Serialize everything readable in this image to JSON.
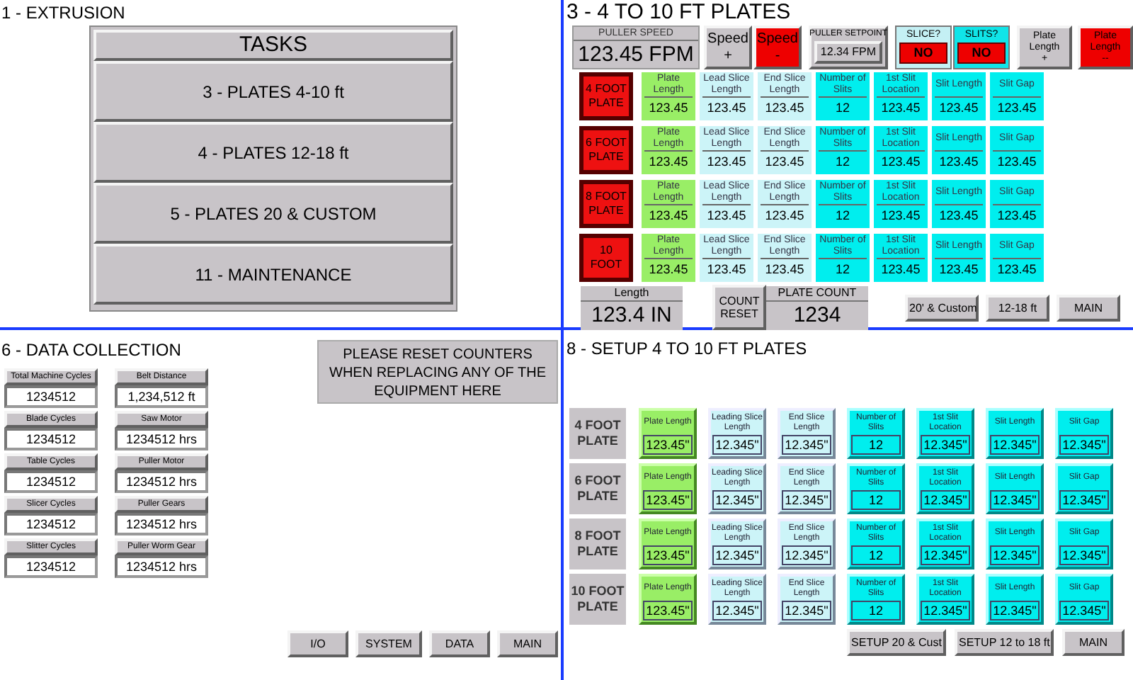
{
  "extrusion": {
    "title": "1 - EXTRUSION",
    "tasks_title": "TASKS",
    "tasks": [
      "3 - PLATES 4-10 ft",
      "4 - PLATES 12-18 ft",
      "5 - PLATES 20 & CUSTOM",
      "11 - MAINTENANCE"
    ]
  },
  "plates": {
    "title": "3 - 4 TO 10 FT PLATES",
    "controls": [
      {
        "kind": "readout",
        "label": "PULLER SPEED",
        "value": "123.45 FPM"
      },
      {
        "kind": "button",
        "label": "Speed",
        "sign": "+",
        "color": "#c8c4c8"
      },
      {
        "kind": "button",
        "label": "Speed",
        "sign": "-",
        "color": "#ee0000"
      },
      {
        "kind": "setpoint",
        "label": "PULLER SETPOINT",
        "value": "12.34 FPM"
      },
      {
        "kind": "toggle",
        "label": "SLICE?",
        "value": "NO",
        "color": "#c4f0f4"
      },
      {
        "kind": "toggle",
        "label": "SLITS?",
        "value": "NO",
        "color": "#10e4e8"
      },
      {
        "kind": "small_button",
        "label": "Plate Length",
        "sign": "+",
        "color": "#c8c4c8"
      },
      {
        "kind": "small_button",
        "label": "Plate Length",
        "sign": "--",
        "color": "#ee0000"
      }
    ],
    "rows": [
      {
        "label": "4 FOOT PLATE",
        "fields": [
          {
            "kind": "plate",
            "label": "Plate Length",
            "value": "123.45"
          },
          {
            "kind": "slice",
            "label": "Lead Slice Length",
            "value": "123.45"
          },
          {
            "kind": "slice",
            "label": "End Slice Length",
            "value": "123.45"
          },
          {
            "kind": "slit",
            "label": "Number of Slits",
            "value": "12"
          },
          {
            "kind": "slit",
            "label": "1st Slit Location",
            "value": "123.45"
          },
          {
            "kind": "slit",
            "label": "Slit Length",
            "value": "123.45"
          },
          {
            "kind": "slit",
            "label": "Slit Gap",
            "value": "123.45"
          }
        ]
      },
      {
        "label": "6 FOOT PLATE",
        "fields": [
          {
            "kind": "plate",
            "label": "Plate Length",
            "value": "123.45"
          },
          {
            "kind": "slice",
            "label": "Lead Slice Length",
            "value": "123.45"
          },
          {
            "kind": "slice",
            "label": "End Slice Length",
            "value": "123.45"
          },
          {
            "kind": "slit",
            "label": "Number of Slits",
            "value": "12"
          },
          {
            "kind": "slit",
            "label": "1st Slit Location",
            "value": "123.45"
          },
          {
            "kind": "slit",
            "label": "Slit Length",
            "value": "123.45"
          },
          {
            "kind": "slit",
            "label": "Slit Gap",
            "value": "123.45"
          }
        ]
      },
      {
        "label": "8 FOOT PLATE",
        "fields": [
          {
            "kind": "plate",
            "label": "Plate Length",
            "value": "123.45"
          },
          {
            "kind": "slice",
            "label": "Lead Slice Length",
            "value": "123.45"
          },
          {
            "kind": "slice",
            "label": "End Slice Length",
            "value": "123.45"
          },
          {
            "kind": "slit",
            "label": "Number of Slits",
            "value": "12"
          },
          {
            "kind": "slit",
            "label": "1st Slit Location",
            "value": "123.45"
          },
          {
            "kind": "slit",
            "label": "Slit Length",
            "value": "123.45"
          },
          {
            "kind": "slit",
            "label": "Slit Gap",
            "value": "123.45"
          }
        ]
      },
      {
        "label": "10 FOOT",
        "fields": [
          {
            "kind": "plate",
            "label": "Plate Length",
            "value": "123.45"
          },
          {
            "kind": "slice",
            "label": "Lead Slice Length",
            "value": "123.45"
          },
          {
            "kind": "slice",
            "label": "End Slice Length",
            "value": "123.45"
          },
          {
            "kind": "slit",
            "label": "Number of Slits",
            "value": "12"
          },
          {
            "kind": "slit",
            "label": "1st Slit Location",
            "value": "123.45"
          },
          {
            "kind": "slit",
            "label": "Slit Length",
            "value": "123.45"
          },
          {
            "kind": "slit",
            "label": "Slit Gap",
            "value": "123.45"
          }
        ]
      }
    ],
    "length": {
      "label": "Length",
      "value": "123.4 IN"
    },
    "count_reset": "COUNT RESET",
    "plate_count": {
      "label": "PLATE COUNT",
      "value": "1234"
    },
    "nav": [
      "20' & Custom",
      "12-18 ft",
      "MAIN"
    ]
  },
  "data_collection": {
    "title": "6 - DATA COLLECTION",
    "counters": [
      {
        "label": "Total Machine Cycles",
        "value": "1234512"
      },
      {
        "label": "Belt Distance",
        "value": "1,234,512 ft"
      },
      {
        "label": "Blade Cycles",
        "value": "1234512"
      },
      {
        "label": "Saw Motor",
        "value": "1234512 hrs"
      },
      {
        "label": "Table Cycles",
        "value": "1234512"
      },
      {
        "label": "Puller Motor",
        "value": "1234512 hrs"
      },
      {
        "label": "Slicer Cycles",
        "value": "1234512"
      },
      {
        "label": "Puller Gears",
        "value": "1234512 hrs"
      },
      {
        "label": "Slitter Cycles",
        "value": "1234512"
      },
      {
        "label": "Puller Worm Gear",
        "value": "1234512 hrs"
      }
    ],
    "notice": "PLEASE RESET COUNTERS WHEN REPLACING ANY OF THE EQUIPMENT HERE",
    "nav": [
      "I/O",
      "SYSTEM",
      "DATA",
      "MAIN"
    ]
  },
  "setup": {
    "title": "8 - SETUP 4 TO 10 FT PLATES",
    "rows": [
      {
        "label": "4 FOOT PLATE",
        "fields": [
          {
            "kind": "plate",
            "label": "Plate Length",
            "value": "123.45\""
          },
          {
            "kind": "slice",
            "label": "Leading Slice Length",
            "value": "12.345\""
          },
          {
            "kind": "slice",
            "label": "End Slice Length",
            "value": "12.345\""
          },
          {
            "kind": "slit",
            "label": "Number of Slits",
            "value": "12"
          },
          {
            "kind": "slit",
            "label": "1st Slit Location",
            "value": "12.345\""
          },
          {
            "kind": "slit",
            "label": "Slit Length",
            "value": "12.345\""
          },
          {
            "kind": "slit",
            "label": "Slit Gap",
            "value": "12.345\""
          }
        ]
      },
      {
        "label": "6 FOOT PLATE",
        "fields": [
          {
            "kind": "plate",
            "label": "Plate Length",
            "value": "123.45\""
          },
          {
            "kind": "slice",
            "label": "Leading Slice Length",
            "value": "12.345\""
          },
          {
            "kind": "slice",
            "label": "End Slice Length",
            "value": "12.345\""
          },
          {
            "kind": "slit",
            "label": "Number of Slits",
            "value": "12"
          },
          {
            "kind": "slit",
            "label": "1st Slit Location",
            "value": "12.345\""
          },
          {
            "kind": "slit",
            "label": "Slit Length",
            "value": "12.345\""
          },
          {
            "kind": "slit",
            "label": "Slit Gap",
            "value": "12.345\""
          }
        ]
      },
      {
        "label": "8 FOOT PLATE",
        "fields": [
          {
            "kind": "plate",
            "label": "Plate Length",
            "value": "123.45\""
          },
          {
            "kind": "slice",
            "label": "Leading Slice Length",
            "value": "12.345\""
          },
          {
            "kind": "slice",
            "label": "End Slice Length",
            "value": "12.345\""
          },
          {
            "kind": "slit",
            "label": "Number of Slits",
            "value": "12"
          },
          {
            "kind": "slit",
            "label": "1st Slit Location",
            "value": "12.345\""
          },
          {
            "kind": "slit",
            "label": "Slit Length",
            "value": "12.345\""
          },
          {
            "kind": "slit",
            "label": "Slit Gap",
            "value": "12.345\""
          }
        ]
      },
      {
        "label": "10 FOOT PLATE",
        "fields": [
          {
            "kind": "plate",
            "label": "Plate Length",
            "value": "123.45\""
          },
          {
            "kind": "slice",
            "label": "Leading Slice Length",
            "value": "12.345\""
          },
          {
            "kind": "slice",
            "label": "End Slice Length",
            "value": "12.345\""
          },
          {
            "kind": "slit",
            "label": "Number of Slits",
            "value": "12"
          },
          {
            "kind": "slit",
            "label": "1st Slit Location",
            "value": "12.345\""
          },
          {
            "kind": "slit",
            "label": "Slit Length",
            "value": "12.345\""
          },
          {
            "kind": "slit",
            "label": "Slit Gap",
            "value": "12.345\""
          }
        ]
      }
    ],
    "nav": [
      "SETUP 20 & Cust",
      "SETUP 12 to 18 ft",
      "MAIN"
    ]
  }
}
